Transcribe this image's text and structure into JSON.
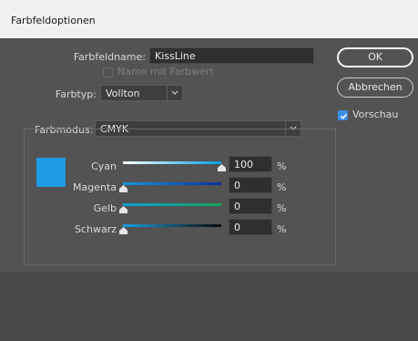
{
  "window": {
    "title": "Farbfeldoptionen"
  },
  "swatch_name": {
    "label": "Farbfeldname:",
    "value": "KissLine"
  },
  "name_with_color": {
    "label": "Name mit Farbwert",
    "checked": false
  },
  "color_type": {
    "label": "Farbtyp:",
    "value": "Vollton"
  },
  "color_mode": {
    "label": "Farbmodus:",
    "value": "CMYK"
  },
  "buttons": {
    "ok": "OK",
    "cancel": "Abbrechen"
  },
  "preview": {
    "label": "Vorschau",
    "checked": true
  },
  "swatch_color": "#1e9be3",
  "channels": [
    {
      "name": "Cyan",
      "value": "100",
      "unit": "%",
      "level": 100,
      "gradient": [
        "#ffffff",
        "#00a2e8"
      ]
    },
    {
      "name": "Magenta",
      "value": "0",
      "unit": "%",
      "level": 0,
      "gradient": [
        "#1299de",
        "#0c2f9e"
      ]
    },
    {
      "name": "Gelb",
      "value": "0",
      "unit": "%",
      "level": 0,
      "gradient": [
        "#0ea0d4",
        "#13a35a"
      ]
    },
    {
      "name": "Schwarz",
      "value": "0",
      "unit": "%",
      "level": 0,
      "gradient": [
        "#1a9ee0",
        "#0a0a0a"
      ]
    }
  ]
}
